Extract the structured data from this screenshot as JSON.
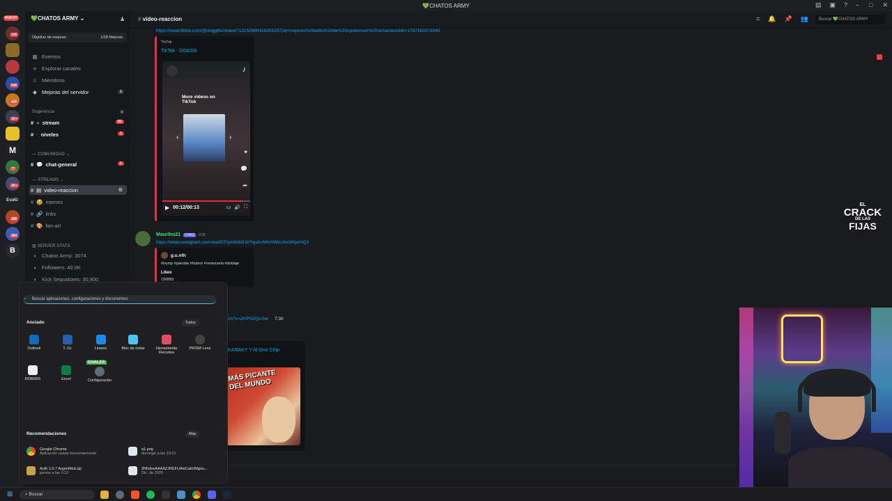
{
  "window": {
    "title": "💚CHATOS ARMY"
  },
  "rail": {
    "top_badge": "NUEVO",
    "badges": [
      "142",
      "546",
      "435",
      "1K+",
      "77",
      "2K+",
      "286",
      "284"
    ],
    "label": "EsdG"
  },
  "sidebar": {
    "server_name": "💚CHATOS ARMY",
    "boost": {
      "label": "Objetivo de mejoras",
      "progress": "1/28 Mejoras"
    },
    "nav": [
      {
        "label": "Eventos"
      },
      {
        "label": "Explorar canales"
      },
      {
        "label": "Miembros"
      },
      {
        "label": "Mejoras del servidor",
        "badge": "1"
      }
    ],
    "cat_sugerencia": "Sugerencia",
    "chan_stream": {
      "label": "stream",
      "badge": "91"
    },
    "chan_niveles": {
      "label": "niveles",
      "badge": "1"
    },
    "cat_comunidad": "COMUNIDAD",
    "chan_chat_general": {
      "label": "chat-general",
      "badge": "1"
    },
    "cat_streams": "STREAMS",
    "chan_video_reaccion": {
      "label": "video-reaccion"
    },
    "chan_memes": {
      "label": "memes"
    },
    "chan_links": {
      "label": "links"
    },
    "chan_fan_art": {
      "label": "fan-art"
    },
    "stats_title": "SERVER STATS",
    "stats": [
      "Chatos Army: 3074",
      "Followers: 40.0K",
      "Kick Seguidores: 30,800"
    ]
  },
  "header": {
    "channel": "video-reaccion",
    "search_placeholder": "Buscar 💚CHATOS ARMY"
  },
  "chat": {
    "link1": "https://www.tiktok.com/@dogg6tv/video/7131529804162552372q=mejores%20edits%20de%20spiderman%20remastered&t=1767163073945",
    "embed1": {
      "provider": "TikTok",
      "title": "TikTok · DOGG6",
      "overlay": "More videos on TikTok",
      "time": "00:12/00:13"
    },
    "msg2": {
      "author": "Mauriho21",
      "tag": "CHAD",
      "time": "0:30",
      "link": "https://www.instagram.com/reel/DTIym69Id1X/?igsh=MnV6Mzc3eGNyeHQ3"
    },
    "embed2": {
      "author": "g.u.nth",
      "text": "#trump #parodia #humor #venezuela #doblaje",
      "likes_label": "Likes",
      "likes_value": "150883"
    },
    "link3_tail": "ch?v=2lYP0ZQVJvk",
    "link3_time": "7:30",
    "embed3_title": "KANAKY Y Al One Chip",
    "thumb_text": "MÁS PICANTE DEL MUNDO"
  },
  "start_menu": {
    "search_placeholder": "Buscar aplicaciones, configuraciones y documentos",
    "pinned_title": "Anclado",
    "all_button": "Todos",
    "apps": [
      {
        "name": "Outlook"
      },
      {
        "name": "T. Gr."
      },
      {
        "name": "Linwes."
      },
      {
        "name": "Bloc de notas"
      },
      {
        "name": "Herramienta Recortes"
      },
      {
        "name": "PRISM Lens"
      },
      {
        "name": "RDBM26"
      },
      {
        "name": "Excel"
      },
      {
        "name": "Configuración"
      }
    ],
    "chales_label": "CHALES",
    "recs_title": "Recomendaciones",
    "more_button": "Más",
    "recs": [
      {
        "name": "Google Chrome",
        "sub": "Aplicación usada frecuentemente"
      },
      {
        "name": "a1.png",
        "sub": "domingo a las 19:21"
      },
      {
        "name": "Auth 1.0.7 ArgenMod.zip",
        "sub": "jueves a las 3:12"
      },
      {
        "name": "2NfoEwAAAAZJREFUAwCakUMgnu...",
        "sub": "Dic. de 2025"
      }
    ]
  },
  "overlay_logo": {
    "line1": "EL",
    "line2": "CRACK",
    "line3": "DE LAS",
    "line4": "FIJAS"
  },
  "taskbar": {
    "search_label": "Buscar"
  },
  "colors": {
    "accent": "#5865f2",
    "mention_red": "#f23f43",
    "link": "#00a8fc",
    "embed_bar": "#e92a4b"
  }
}
